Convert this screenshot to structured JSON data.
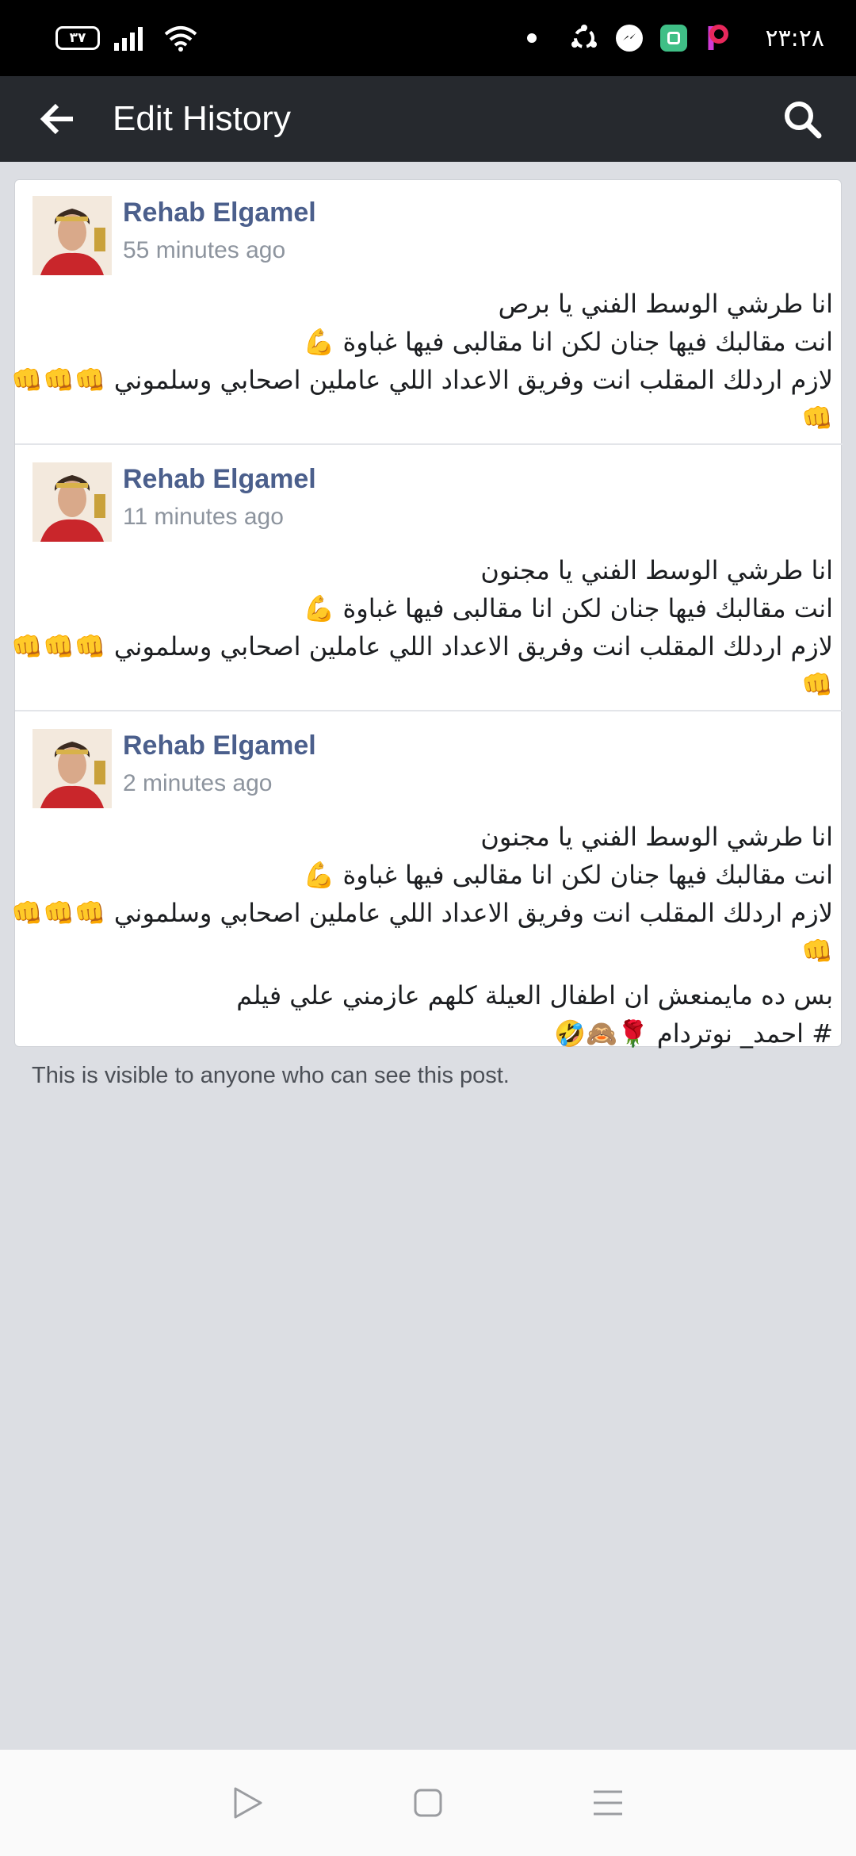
{
  "status_bar": {
    "battery": "٣٧",
    "clock": "٢٣:٢٨",
    "icons": [
      "signal-icon",
      "wifi-icon",
      "notification-dot-icon",
      "share-app-icon",
      "messenger-icon",
      "green-app-icon",
      "picsart-icon"
    ]
  },
  "app_bar": {
    "title": "Edit History",
    "back_icon": "back-arrow-icon",
    "search_icon": "search-icon"
  },
  "entries": [
    {
      "author": "Rehab Elgamel",
      "time": "55 minutes ago",
      "lines": [
        "انا طرشي الوسط الفني يا برص",
        "انت مقالبك فيها جنان لكن انا مقالبى فيها غباوة 💪",
        "لازم اردلك المقلب انت وفريق الاعداد اللي عاملين اصحابي وسلموني 👊👊👊",
        "👊"
      ]
    },
    {
      "author": "Rehab Elgamel",
      "time": "11 minutes ago",
      "lines": [
        "انا طرشي الوسط الفني يا مجنون",
        "انت مقالبك فيها جنان لكن انا مقالبى فيها غباوة 💪",
        "لازم اردلك المقلب انت وفريق الاعداد اللي عاملين اصحابي وسلموني 👊👊👊",
        "👊"
      ]
    },
    {
      "author": "Rehab Elgamel",
      "time": "2 minutes ago",
      "lines": [
        "انا طرشي الوسط الفني يا مجنون",
        "انت مقالبك فيها جنان لكن انا مقالبى فيها غباوة 💪",
        "لازم اردلك المقلب انت وفريق الاعداد اللي عاملين اصحابي وسلموني 👊👊👊",
        "👊",
        "",
        "بس ده مايمنعش ان اطفال العيلة كلهم عازمني علي فيلم",
        "# احمد_ نوتردام 🌹🙈🤣"
      ]
    }
  ],
  "footer_note": "This is visible to anyone who can see this post.",
  "nav_bar": {
    "icons": [
      "back-triangle-icon",
      "home-square-icon",
      "menu-lines-icon"
    ]
  },
  "colors": {
    "app_bar": "#26292e",
    "author": "#4b5f8c",
    "background": "#dcdee3"
  }
}
